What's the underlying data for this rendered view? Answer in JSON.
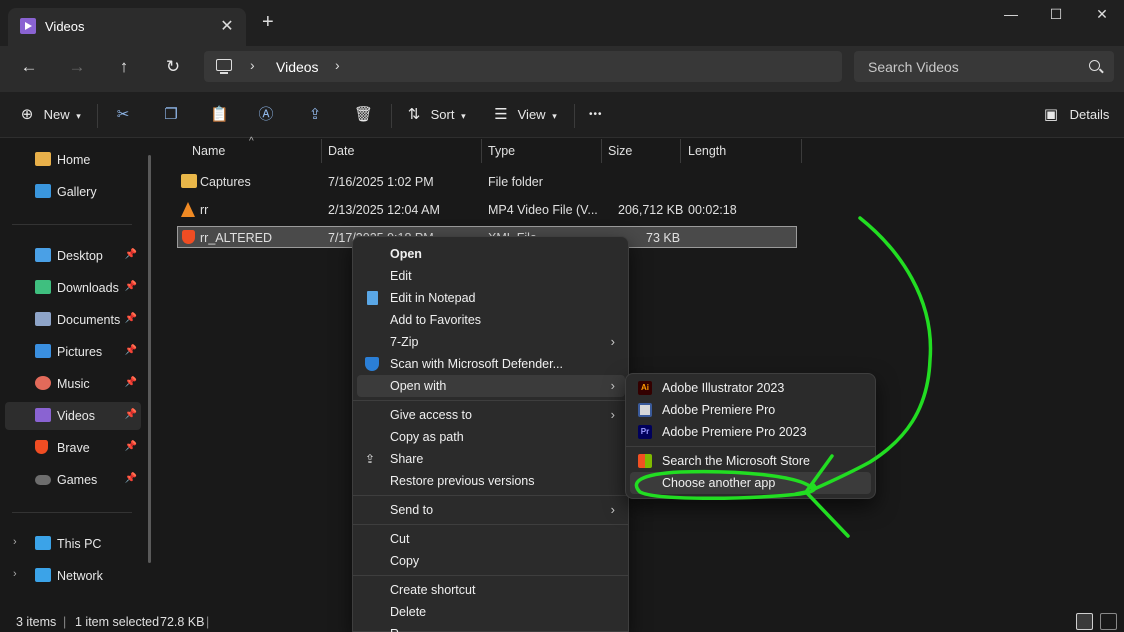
{
  "window": {
    "tab_title": "Videos",
    "new_tab_symbol": "+",
    "close_tab_symbol": "✕",
    "minimize_symbol": "—",
    "maximize_symbol": "☐",
    "close_symbol": "✕"
  },
  "address": {
    "crumb": "Videos",
    "search_placeholder": "Search Videos"
  },
  "toolbar": {
    "new_label": "New",
    "sort_label": "Sort",
    "view_label": "View",
    "details_label": "Details",
    "more_symbol": "•••"
  },
  "sidebar": {
    "items": [
      {
        "label": "Home",
        "color": "#e8b04a"
      },
      {
        "label": "Gallery",
        "color": "#3a96dd"
      },
      {
        "label": "Desktop",
        "color": "#4aa0e6"
      },
      {
        "label": "Downloads",
        "color": "#3fbf7f"
      },
      {
        "label": "Documents",
        "color": "#8ea4c8"
      },
      {
        "label": "Pictures",
        "color": "#3a8fe0"
      },
      {
        "label": "Music",
        "color": "#e26a5a"
      },
      {
        "label": "Videos",
        "color": "#8a63d2"
      },
      {
        "label": "Brave",
        "color": "#f04d23"
      },
      {
        "label": "Games",
        "color": "#6d6d6d"
      },
      {
        "label": "This PC",
        "color": "#3ba3e8"
      },
      {
        "label": "Network",
        "color": "#3ba3e8"
      }
    ]
  },
  "files": {
    "columns": [
      "Name",
      "Date",
      "Type",
      "Size",
      "Length"
    ],
    "rows": [
      {
        "name": "Captures",
        "date": "7/16/2025 1:02 PM",
        "type": "File folder",
        "size": "",
        "length": ""
      },
      {
        "name": "rr",
        "date": "2/13/2025 12:04 AM",
        "type": "MP4 Video File (V...",
        "size": "206,712 KB",
        "length": "00:02:18"
      },
      {
        "name": "rr_ALTERED",
        "date": "7/17/2025 9:18 PM",
        "type": "XML File",
        "size": "73 KB",
        "length": ""
      }
    ]
  },
  "status": {
    "items_count": "3 items",
    "selected": "1 item selected",
    "selected_size": "72.8 KB"
  },
  "context_menu": {
    "items": [
      "Open",
      "Edit",
      "Edit in Notepad",
      "Add to Favorites",
      "7-Zip",
      "Scan with Microsoft Defender...",
      "Open with",
      "Give access to",
      "Copy as path",
      "Share",
      "Restore previous versions",
      "Send to",
      "Cut",
      "Copy",
      "Create shortcut",
      "Delete",
      "R"
    ]
  },
  "open_with_menu": {
    "items": [
      {
        "label": "Adobe Illustrator 2023",
        "badge": "Ai"
      },
      {
        "label": "Adobe Premiere Pro",
        "badge": ""
      },
      {
        "label": "Adobe Premiere Pro 2023",
        "badge": "Pr"
      },
      {
        "label": "Search the Microsoft Store",
        "badge": ""
      },
      {
        "label": "Choose another app",
        "badge": ""
      }
    ]
  },
  "colors": {
    "annotation": "#22dd22",
    "accent": "#8fb6e8"
  }
}
